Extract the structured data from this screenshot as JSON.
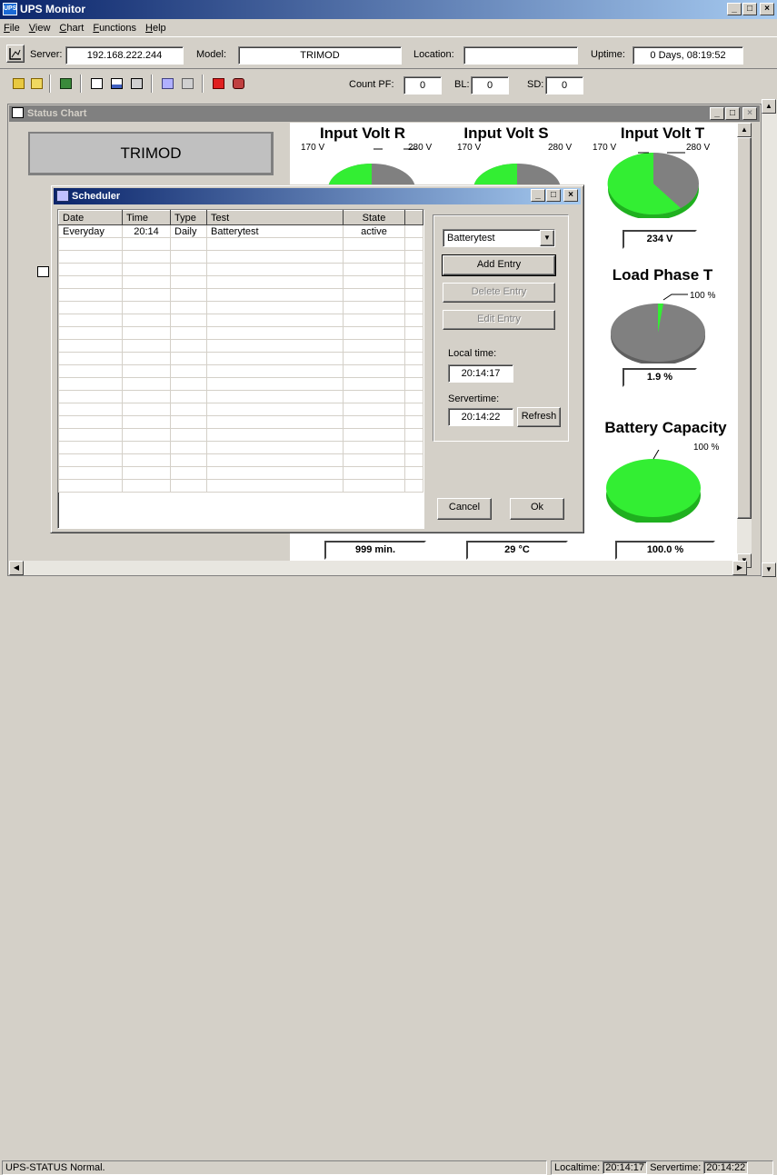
{
  "window": {
    "title": "UPS Monitor"
  },
  "menu": [
    "File",
    "View",
    "Chart",
    "Functions",
    "Help"
  ],
  "info_bar": {
    "server_label": "Server:",
    "server_value": "192.168.222.244",
    "model_label": "Model:",
    "model_value": "TRIMOD",
    "location_label": "Location:",
    "location_value": "",
    "uptime_label": "Uptime:",
    "uptime_value": "0 Days, 08:19:52"
  },
  "toolbar": {
    "count_pf_label": "Count PF:",
    "count_pf_value": "0",
    "bl_label": "BL:",
    "bl_value": "0",
    "sd_label": "SD:",
    "sd_value": "0"
  },
  "status_chart": {
    "title": "Status Chart",
    "model_box": "TRIMOD",
    "gauges": {
      "input_r": {
        "title": "Input Volt R",
        "min": "170 V",
        "max": "280 V"
      },
      "input_s": {
        "title": "Input Volt S",
        "min": "170 V",
        "max": "280 V"
      },
      "input_t": {
        "title": "Input Volt T",
        "min": "170 V",
        "max": "280 V",
        "value": "234 V",
        "fraction": 0.58
      },
      "load_t": {
        "title": "Load Phase T",
        "max": "100 %",
        "value": "1.9 %",
        "fraction": 0.019
      },
      "battery": {
        "title": "Battery Capacity",
        "max": "100 %",
        "value": "100.0 %",
        "fraction": 1.0
      }
    },
    "bottom_values": {
      "runtime": "999 min.",
      "temperature": "29 °C"
    }
  },
  "scheduler": {
    "title": "Scheduler",
    "columns": [
      "Date",
      "Time",
      "Type",
      "Test",
      "State"
    ],
    "rows": [
      {
        "date": "Everyday",
        "time": "20:14",
        "type": "Daily",
        "test": "Batterytest",
        "state": "active"
      }
    ],
    "test_select": "Batterytest",
    "add_entry": "Add Entry",
    "delete_entry": "Delete Entry",
    "edit_entry": "Edit Entry",
    "local_time_label": "Local time:",
    "local_time": "20:14:17",
    "servertime_label": "Servertime:",
    "servertime": "20:14:22",
    "refresh": "Refresh",
    "cancel": "Cancel",
    "ok": "Ok"
  },
  "statusbar": {
    "message": "UPS-STATUS Normal.",
    "localtime_label": "Localtime:",
    "localtime": "20:14:17",
    "servertime_label": "Servertime:",
    "servertime": "20:14:22"
  },
  "colors": {
    "green": "#33ee33",
    "gray": "#808080",
    "title_blue": "#0a246a"
  }
}
